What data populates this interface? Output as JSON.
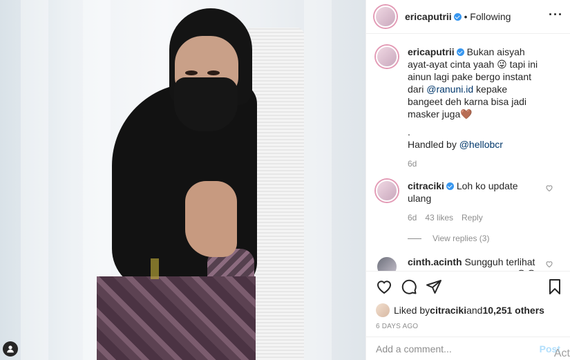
{
  "post_author": {
    "username": "ericaputrii",
    "follow_status": "Following",
    "separator": "•"
  },
  "caption": {
    "username": "ericaputrii",
    "text_part1": " Bukan aisyah ayat-ayat cinta yaah 😜 tapi ini ainun lagi pake bergo instant dari ",
    "mention1": "@ranuni.id",
    "text_part2": " kepake bangeet deh karna bisa jadi masker juga🤎",
    "dot": ".",
    "handled_label": "Handled by ",
    "mention2": "@hellobcr",
    "age": "6d"
  },
  "comments": [
    {
      "username": "citraciki",
      "text": " Loh ko update ulang",
      "age": "6d",
      "likes": "43 likes",
      "reply_label": "Reply",
      "view_replies": "View replies (3)"
    },
    {
      "username": "cinth.acinth",
      "text": " Sungguh terlihat lebih cuuaantikk bgt kaka😍😋😋"
    }
  ],
  "actions": {
    "like_icon": "heart-icon",
    "comment_icon": "comment-icon",
    "share_icon": "share-icon",
    "save_icon": "bookmark-icon"
  },
  "likes": {
    "prefix": "Liked by ",
    "user": "citraciki",
    "middle": " and ",
    "count": "10,251 others"
  },
  "timestamp": "6 DAYS AGO",
  "add_comment": {
    "placeholder": "Add a comment...",
    "post_label": "Post"
  },
  "watermark": "Act",
  "colors": {
    "verified": "#3897f0",
    "link": "#00376b",
    "muted": "#8e8e8e",
    "post_button": "#b2dffc"
  }
}
